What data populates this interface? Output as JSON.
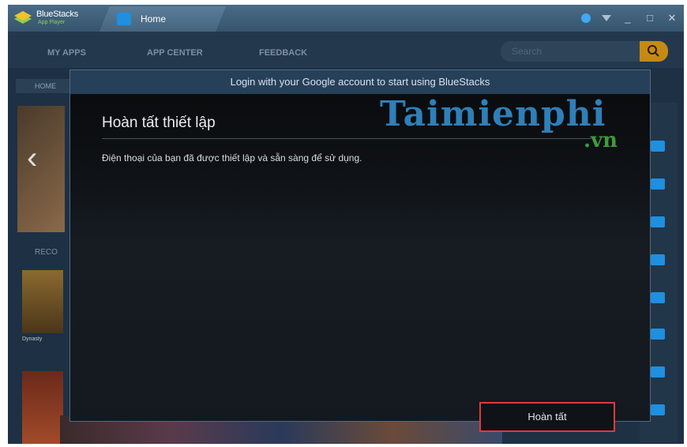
{
  "app": {
    "logo_title": "BlueStacks",
    "logo_subtitle": "App Player",
    "tab_label": "Home"
  },
  "nav": {
    "items": [
      "MY APPS",
      "APP CENTER",
      "FEEDBACK"
    ],
    "search_placeholder": "Search"
  },
  "content": {
    "home_tab": "HOME",
    "recommended_label": "RECO",
    "thumb_caption": "Dynasty"
  },
  "modal": {
    "header": "Login with your Google account to start using BlueStacks",
    "heading": "Hoàn tất thiết lập",
    "message": "Điện thoại của bạn đã được thiết lập và sẵn sàng để sử dụng.",
    "done_button": "Hoàn tất"
  },
  "watermark": {
    "main": "Taimienphi",
    "sub": ".vn"
  },
  "colors": {
    "accent_blue": "#1f8fe0",
    "highlight_red": "#e03a3a",
    "search_gold": "#c48a14"
  }
}
